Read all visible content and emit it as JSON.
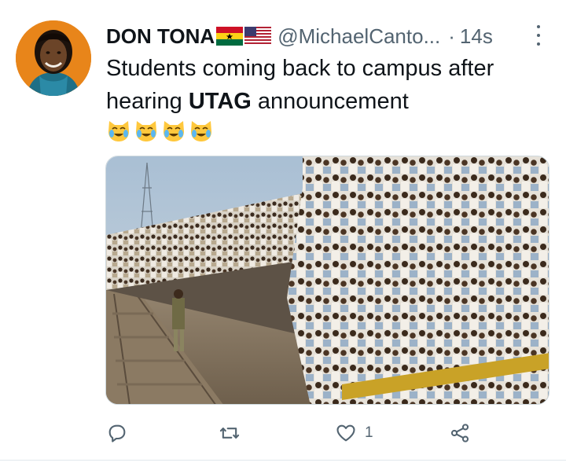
{
  "tweet": {
    "display_name": "DON TONA",
    "flags": [
      "ghana-flag",
      "usa-flag"
    ],
    "handle": "@MichaelCanto...",
    "separator": "·",
    "time": "14s",
    "text_line1": "Students coming back to campus after",
    "text_line2_pre": "hearing ",
    "text_line2_bold": "UTAG",
    "text_line2_post": " announcement",
    "emojis": [
      "crying-cat-icon",
      "crying-cat-icon",
      "crying-cat-icon",
      "crying-cat-icon"
    ]
  },
  "actions": {
    "reply_icon": "reply-icon",
    "retweet_icon": "retweet-icon",
    "like_icon": "heart-icon",
    "like_count": "1",
    "share_icon": "share-icon"
  },
  "colors": {
    "text": "#0f1419",
    "muted": "#536471",
    "avatar_bg": "#e8851a"
  }
}
